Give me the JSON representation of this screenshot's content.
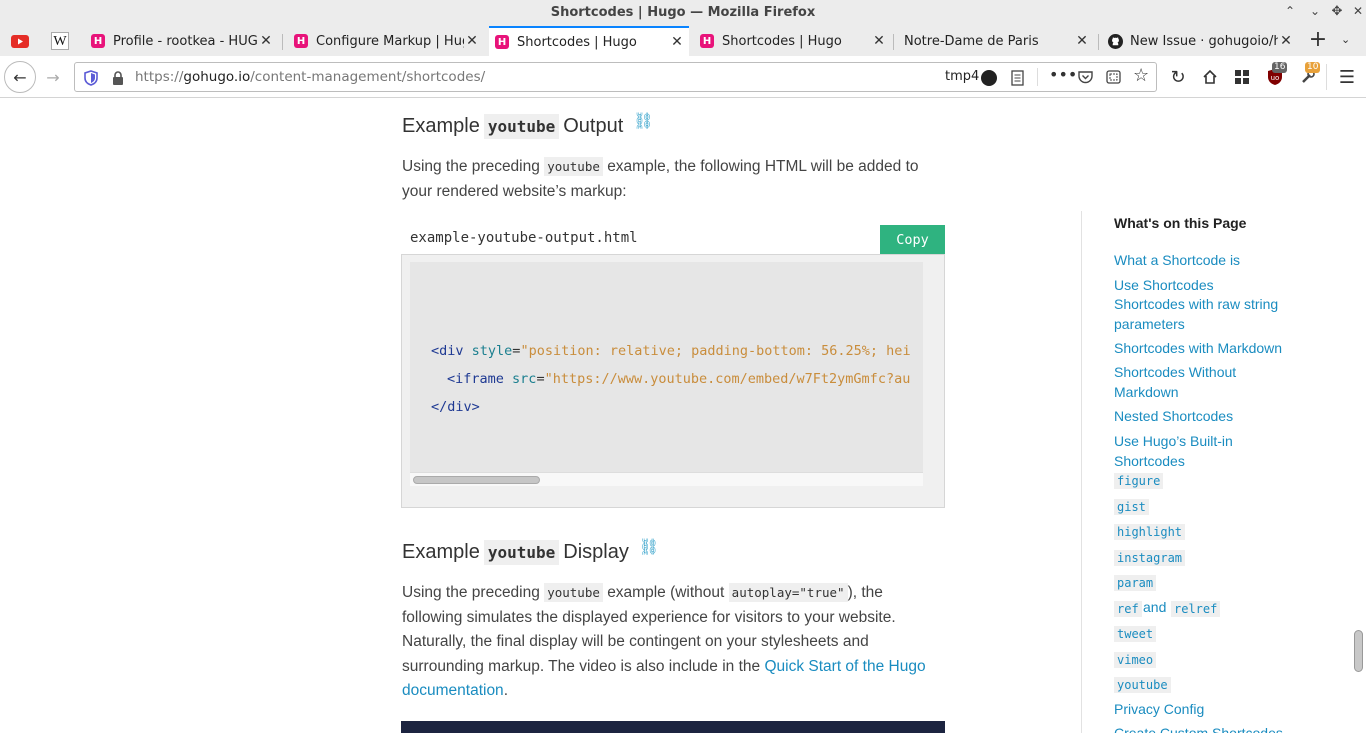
{
  "window": {
    "title": "Shortcodes | Hugo — Mozilla Firefox"
  },
  "tabs": [
    {
      "label": "Profile - rootkea - HUGO"
    },
    {
      "label": "Configure Markup | Hug"
    },
    {
      "label": "Shortcodes | Hugo"
    },
    {
      "label": "Shortcodes | Hugo"
    },
    {
      "label": "Notre-Dame de Paris"
    },
    {
      "label": "New Issue · gohugoio/hu"
    }
  ],
  "navbar": {
    "url_prefix": "https://",
    "url_domain": "gohugo.io",
    "url_path": "/content-management/shortcodes/",
    "container_label": "tmp4",
    "ublock_count": "16",
    "ext_count": "10"
  },
  "content": {
    "section1": {
      "heading_pre": "Example",
      "heading_code": "youtube",
      "heading_post": "Output",
      "para_a": "Using the preceding",
      "para_code": "youtube",
      "para_b": "example, the following HTML will be added to your rendered website’s markup:"
    },
    "code_block": {
      "filename": "example-youtube-output.html",
      "copy_label": "Copy",
      "line1_tag_open": "<div",
      "line1_attr": "style",
      "line1_eq": "=",
      "line1_str": "\"position: relative; padding-bottom: 56.25%; hei",
      "line2_tag_open": "<iframe",
      "line2_attr": "src",
      "line2_eq": "=",
      "line2_str": "\"https://www.youtube.com/embed/w7Ft2ymGmfc?au",
      "line3_tag": "</div>"
    },
    "section2": {
      "heading_pre": "Example",
      "heading_code": "youtube",
      "heading_post": "Display",
      "p_a": "Using the preceding",
      "p_code1": "youtube",
      "p_b": "example (without",
      "p_code2": "autoplay=\"true\"",
      "p_c": "), the following simulates the displayed experience for visitors to your website. Naturally, the final display will be contingent on your stylesheets and surrounding markup. The video is also include in the",
      "p_link": "Quick Start of the Hugo documentation",
      "p_end": "."
    }
  },
  "toc": {
    "title": "What's on this Page",
    "items": [
      "What a Shortcode is",
      "Use Shortcodes",
      "Shortcodes with raw string parameters",
      "Shortcodes with Markdown",
      "Shortcodes Without Markdown",
      "Nested Shortcodes",
      "Use Hugo’s Built-in Shortcodes",
      "Privacy Config",
      "Create Custom Shortcodes"
    ],
    "codes": [
      "figure",
      "gist",
      "highlight",
      "instagram",
      "param",
      "ref",
      "relref",
      "tweet",
      "vimeo",
      "youtube"
    ],
    "and_word": "and"
  }
}
